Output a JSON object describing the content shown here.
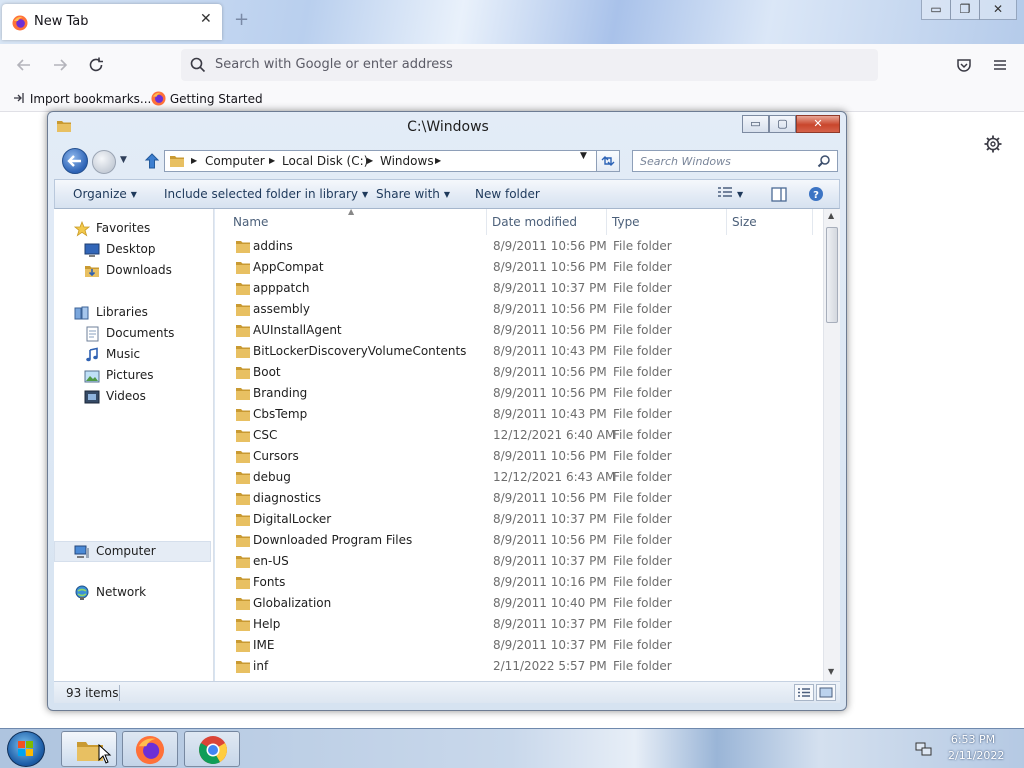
{
  "browser": {
    "tab_title": "New Tab",
    "close_glyph": "✕",
    "new_tab_glyph": "+",
    "window_buttons": {
      "minimize": "▭",
      "restore": "❐",
      "close": "✕"
    },
    "url_placeholder": "Search with Google or enter address",
    "bookmarks": [
      {
        "label": "Import bookmarks..."
      },
      {
        "label": "Getting Started"
      }
    ]
  },
  "explorer": {
    "title": "C:\\Windows",
    "breadcrumbs": [
      "Computer",
      "Local Disk (C:)",
      "Windows"
    ],
    "search_placeholder": "Search Windows",
    "commands": {
      "organize": "Organize",
      "include": "Include selected folder in library",
      "share": "Share with",
      "new_folder": "New folder"
    },
    "columns": {
      "name": "Name",
      "date": "Date modified",
      "type": "Type",
      "size": "Size"
    },
    "nav": {
      "favorites": "Favorites",
      "desktop": "Desktop",
      "downloads": "Downloads",
      "libraries": "Libraries",
      "documents": "Documents",
      "music": "Music",
      "pictures": "Pictures",
      "videos": "Videos",
      "computer": "Computer",
      "network": "Network"
    },
    "files": [
      {
        "name": "addins",
        "date": "8/9/2011 10:56 PM",
        "type": "File folder"
      },
      {
        "name": "AppCompat",
        "date": "8/9/2011 10:56 PM",
        "type": "File folder"
      },
      {
        "name": "apppatch",
        "date": "8/9/2011 10:37 PM",
        "type": "File folder"
      },
      {
        "name": "assembly",
        "date": "8/9/2011 10:56 PM",
        "type": "File folder"
      },
      {
        "name": "AUInstallAgent",
        "date": "8/9/2011 10:56 PM",
        "type": "File folder"
      },
      {
        "name": "BitLockerDiscoveryVolumeContents",
        "date": "8/9/2011 10:43 PM",
        "type": "File folder"
      },
      {
        "name": "Boot",
        "date": "8/9/2011 10:56 PM",
        "type": "File folder"
      },
      {
        "name": "Branding",
        "date": "8/9/2011 10:56 PM",
        "type": "File folder"
      },
      {
        "name": "CbsTemp",
        "date": "8/9/2011 10:43 PM",
        "type": "File folder"
      },
      {
        "name": "CSC",
        "date": "12/12/2021 6:40 AM",
        "type": "File folder"
      },
      {
        "name": "Cursors",
        "date": "8/9/2011 10:56 PM",
        "type": "File folder"
      },
      {
        "name": "debug",
        "date": "12/12/2021 6:43 AM",
        "type": "File folder"
      },
      {
        "name": "diagnostics",
        "date": "8/9/2011 10:56 PM",
        "type": "File folder"
      },
      {
        "name": "DigitalLocker",
        "date": "8/9/2011 10:37 PM",
        "type": "File folder"
      },
      {
        "name": "Downloaded Program Files",
        "date": "8/9/2011 10:56 PM",
        "type": "File folder"
      },
      {
        "name": "en-US",
        "date": "8/9/2011 10:37 PM",
        "type": "File folder"
      },
      {
        "name": "Fonts",
        "date": "8/9/2011 10:16 PM",
        "type": "File folder"
      },
      {
        "name": "Globalization",
        "date": "8/9/2011 10:40 PM",
        "type": "File folder"
      },
      {
        "name": "Help",
        "date": "8/9/2011 10:37 PM",
        "type": "File folder"
      },
      {
        "name": "IME",
        "date": "8/9/2011 10:37 PM",
        "type": "File folder"
      },
      {
        "name": "inf",
        "date": "2/11/2022 5:57 PM",
        "type": "File folder"
      }
    ],
    "status": {
      "item_count": "93 items"
    }
  },
  "taskbar": {
    "time": "6:53 PM",
    "date": "2/11/2022"
  },
  "colors": {
    "folder": "#e8c062",
    "folder_dark": "#c99a32",
    "accent_blue": "#2d63b6"
  }
}
